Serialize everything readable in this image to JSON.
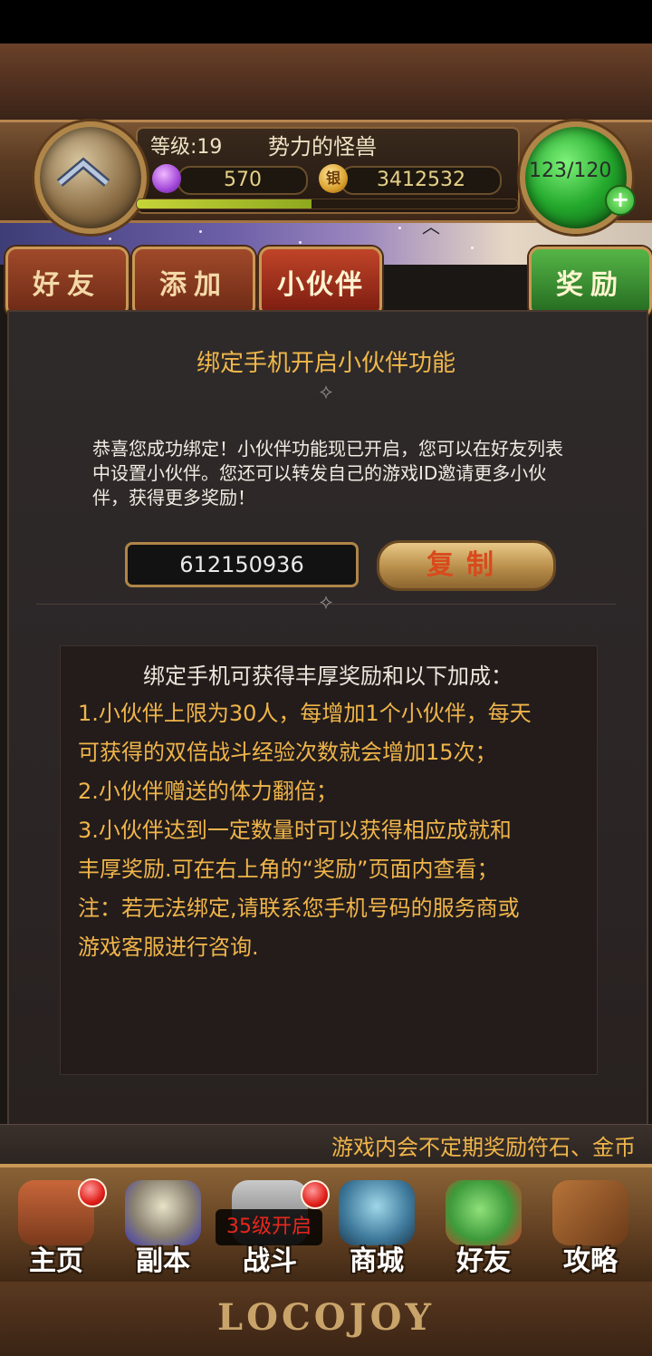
{
  "header": {
    "level_label": "等级:19",
    "player_name": "势力的怪兽",
    "gems": "570",
    "coins": "3412532",
    "coin_symbol": "银",
    "energy": "123/120",
    "exp_progress": 0.46
  },
  "tabs": [
    {
      "label": "好友"
    },
    {
      "label": "添加"
    },
    {
      "label": "小伙伴"
    },
    {
      "label": "奖励"
    }
  ],
  "panel": {
    "title": "绑定手机开启小伙伴功能",
    "congrats": "恭喜您成功绑定！小伙伴功能现已开启，您可以在好友列表中设置小伙伴。您还可以转发自己的游戏ID邀请更多小伙伴，获得更多奖励！",
    "game_id": "612150936",
    "copy_label": "复制",
    "info_heading": "绑定手机可获得丰厚奖励和以下加成：",
    "info_lines": [
      "1.小伙伴上限为30人，每增加1个小伙伴，每天",
      "可获得的双倍战斗经验次数就会增加15次；",
      "2.小伙伴赠送的体力翻倍；",
      "3.小伙伴达到一定数量时可以获得相应成就和",
      "丰厚奖励.可在右上角的“奖励”页面内查看；",
      "注：若无法绑定,请联系您手机号码的服务商或",
      "游戏客服进行咨询."
    ]
  },
  "ticker": "游戏内会不定期奖励符石、金币",
  "nav": [
    {
      "label": "主页",
      "badge": true,
      "icon": "house-icon"
    },
    {
      "label": "副本",
      "badge": false,
      "icon": "skull-icon"
    },
    {
      "label": "战斗",
      "badge": true,
      "icon": "battle-icon",
      "lock_text": "35级开启"
    },
    {
      "label": "商城",
      "badge": false,
      "icon": "monster-shop-icon"
    },
    {
      "label": "好友",
      "badge": false,
      "icon": "friends-monsters-icon"
    },
    {
      "label": "攻略",
      "badge": false,
      "icon": "guide-book-icon"
    }
  ],
  "footer_logo": "LOCOJOY",
  "colors": {
    "accent_gold": "#f0b54a",
    "tab_red": "#a0492a",
    "tab_green": "#55b546",
    "badge_red": "#e0201a"
  }
}
